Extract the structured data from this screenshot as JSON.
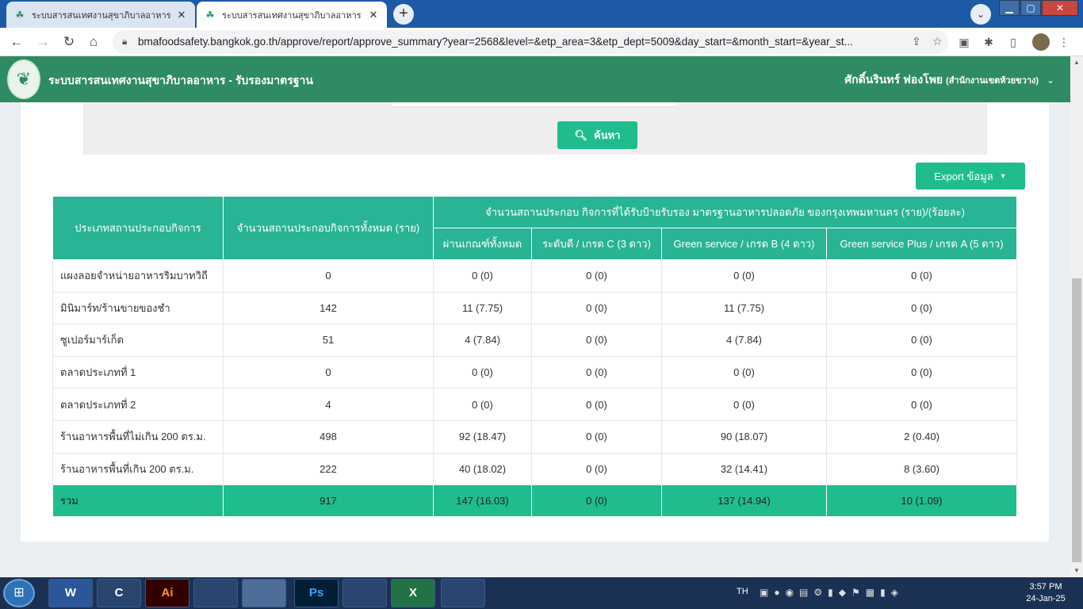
{
  "browser": {
    "tabs": [
      {
        "title": "ระบบสารสนเทศงานสุขาภิบาลอาหาร",
        "active": false
      },
      {
        "title": "ระบบสารสนเทศงานสุขาภิบาลอาหาร",
        "active": true
      }
    ],
    "new_tab": "+",
    "url": "bmafoodsafety.bangkok.go.th/approve/report/approve_summary?year=2568&level=&etp_area=3&etp_dept=5009&day_start=&month_start=&year_st..."
  },
  "app": {
    "title": "ระบบสารสนเทศงานสุขาภิบาลอาหาร - รับรองมาตรฐาน",
    "user_name": "ศักดิ์นรินทร์ ฟองโพย",
    "user_office": "(สำนักงานเขตห้วยขวาง)"
  },
  "filters": {
    "search_label": "ค้นหา"
  },
  "export_label": "Export ข้อมูล",
  "table": {
    "header_type": "ประเภทสถานประกอบกิจการ",
    "header_total": "จำนวนสถานประกอบกิจการทั้งหมด (ราย)",
    "header_group": "จำนวนสถานประกอบ กิจการที่ได้รับป้ายรับรอง มาตรฐานอาหารปลอดภัย ของกรุงเทพมหานคร (ราย)/(ร้อยละ)",
    "sub_headers": [
      "ผ่านเกณฑ์ทั้งหมด",
      "ระดับดี / เกรด C (3 ดาว)",
      "Green service / เกรด B (4 ดาว)",
      "Green service Plus / เกรด A (5 ดาว)"
    ],
    "rows": [
      {
        "type": "แผงลอยจำหน่ายอาหารริมบาทวิถี",
        "total": "0",
        "pass": "0 (0)",
        "c": "0 (0)",
        "b": "0 (0)",
        "a": "0 (0)"
      },
      {
        "type": "มินิมาร์ท/ร้านขายของชำ",
        "total": "142",
        "pass": "11 (7.75)",
        "c": "0 (0)",
        "b": "11 (7.75)",
        "a": "0 (0)"
      },
      {
        "type": "ซูเปอร์มาร์เก็ต",
        "total": "51",
        "pass": "4 (7.84)",
        "c": "0 (0)",
        "b": "4 (7.84)",
        "a": "0 (0)"
      },
      {
        "type": "ตลาดประเภทที่ 1",
        "total": "0",
        "pass": "0 (0)",
        "c": "0 (0)",
        "b": "0 (0)",
        "a": "0 (0)"
      },
      {
        "type": "ตลาดประเภทที่ 2",
        "total": "4",
        "pass": "0 (0)",
        "c": "0 (0)",
        "b": "0 (0)",
        "a": "0 (0)"
      },
      {
        "type": "ร้านอาหารพื้นที่ไม่เกิน 200 ตร.ม.",
        "total": "498",
        "pass": "92 (18.47)",
        "c": "0 (0)",
        "b": "90 (18.07)",
        "a": "2 (0.40)"
      },
      {
        "type": "ร้านอาหารพื้นที่เกิน 200 ตร.ม.",
        "total": "222",
        "pass": "40 (18.02)",
        "c": "0 (0)",
        "b": "32 (14.41)",
        "a": "8 (3.60)"
      }
    ],
    "total_row": {
      "type": "รวม",
      "total": "917",
      "pass": "147 (16.03)",
      "c": "0 (0)",
      "b": "137 (14.94)",
      "a": "10 (1.09)"
    }
  },
  "taskbar": {
    "apps": [
      "W",
      "C",
      "Ai",
      "",
      "",
      "Ps",
      "",
      "X",
      ""
    ],
    "lang": "TH",
    "time": "3:57 PM",
    "date": "24-Jan-25"
  },
  "colors": {
    "header_green": "#2e8b62",
    "accent": "#1fbd8e",
    "table_header": "#28b495"
  }
}
